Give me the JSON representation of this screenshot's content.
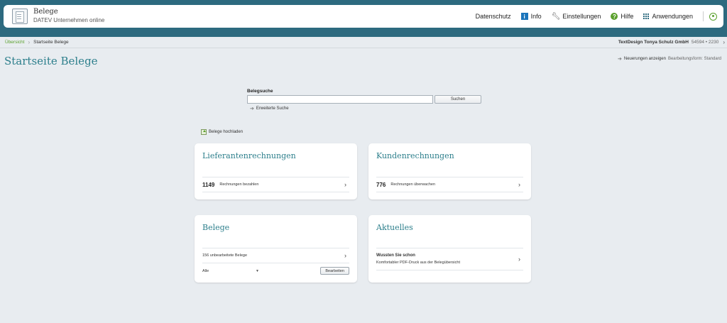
{
  "header": {
    "app_name": "Belege",
    "app_subtitle": "DATEV Unternehmen online",
    "nav": {
      "datenschutz": "Datenschutz",
      "info": "Info",
      "einstellungen": "Einstellungen",
      "hilfe": "Hilfe",
      "anwendungen": "Anwendungen"
    },
    "icons": [
      "info-icon",
      "wrench-icon",
      "help-icon",
      "apps-grid-icon",
      "user-icon"
    ]
  },
  "breadcrumb": {
    "home": "Übersicht",
    "current": "Startseite Belege"
  },
  "company": {
    "name": "TextDesign Tonya Schulz GmbH",
    "number": "54594 • 2230"
  },
  "page": {
    "title": "Startseite Belege",
    "news_link": "Neuerungen anzeigen",
    "mode": "Bearbeitungsform: Standard"
  },
  "search": {
    "label": "Belegsuche",
    "value": "",
    "button": "Suchen",
    "extended": "Erweiterte Suche"
  },
  "upload": {
    "label": "Belege hochladen"
  },
  "cards": {
    "lieferanten": {
      "title": "Lieferantenrechnungen",
      "count": "1149",
      "text": "Rechnungen bezahlen"
    },
    "kunden": {
      "title": "Kundenrechnungen",
      "count": "776",
      "text": "Rechnungen überwachen"
    },
    "belege": {
      "title": "Belege",
      "row_text": "156 unbearbeitete Belege",
      "filter_value": "Alle",
      "edit_button": "Bearbeiten"
    },
    "aktuelles": {
      "title": "Aktuelles",
      "item_title": "Wussten Sie schon",
      "item_text": "Komfortabler PDF-Druck aus der Belegübersicht"
    }
  },
  "colors": {
    "top_band": "#2d6a7f",
    "accent_teal": "#2d7f8c",
    "accent_green": "#5aa02c",
    "background": "#e8ecf0"
  }
}
